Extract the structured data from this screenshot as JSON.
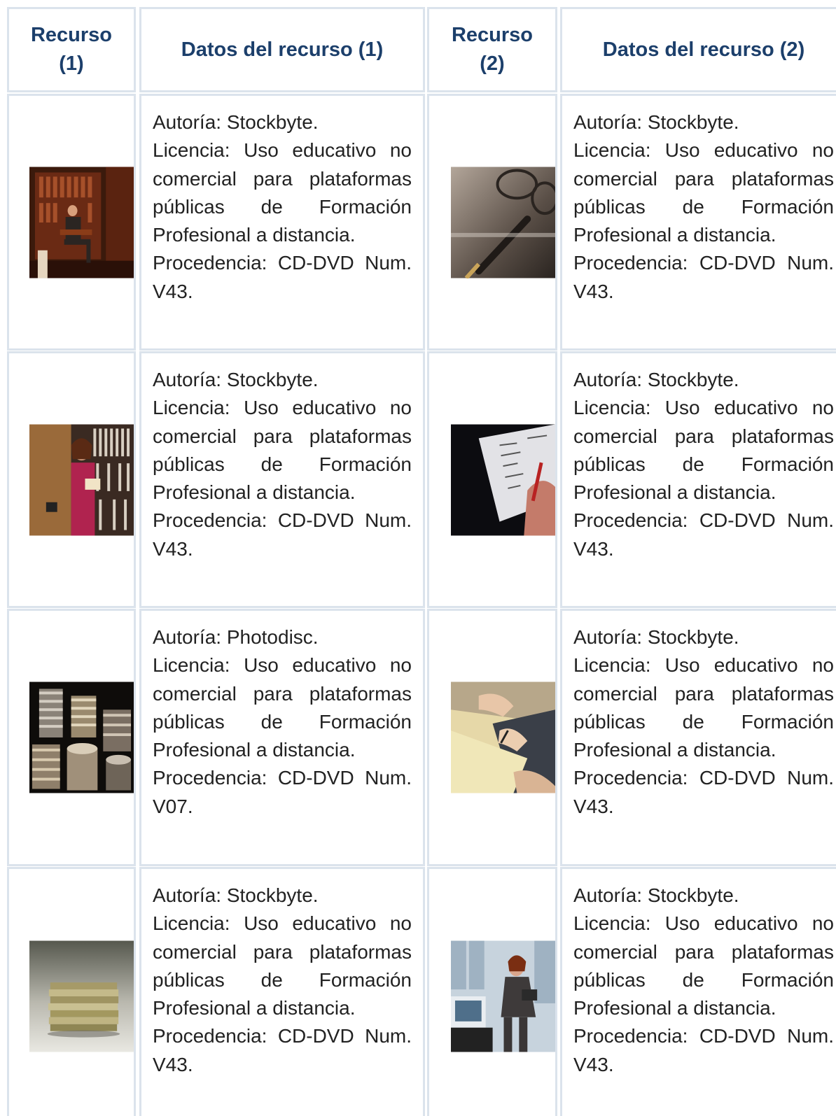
{
  "headers": {
    "recurso1": "Recurso (1)",
    "datos1": "Datos del recurso (1)",
    "recurso2": "Recurso (2)",
    "datos2": "Datos del recurso (2)"
  },
  "rows": [
    {
      "left": {
        "image": "man-seated-in-library-photo",
        "autoria": "Autoría: Stockbyte.",
        "licencia": "Licencia: Uso educativo no comercial para plataformas públicas de Formación Profesional a distancia.",
        "procedencia": "Procedencia: CD-DVD Num. V43."
      },
      "right": {
        "image": "glasses-and-fountain-pen-photo",
        "autoria": "Autoría: Stockbyte.",
        "licencia": "Licencia: Uso educativo no comercial para plataformas públicas de Formación Profesional a distancia.",
        "procedencia": "Procedencia: CD-DVD Num. V43."
      }
    },
    {
      "left": {
        "image": "woman-reading-at-bookshelf-photo",
        "autoria": "Autoría: Stockbyte.",
        "licencia": "Licencia: Uso educativo no comercial para plataformas públicas de Formación Profesional a distancia.",
        "procedencia": "Procedencia: CD-DVD Num. V43."
      },
      "right": {
        "image": "hand-writing-figures-photo",
        "autoria": "Autoría: Stockbyte.",
        "licencia": "Licencia: Uso educativo no comercial para plataformas públicas de Formación Profesional a distancia.",
        "procedencia": "Procedencia: CD-DVD Num. V43."
      }
    },
    {
      "left": {
        "image": "stacked-coins-photo",
        "autoria": "Autoría: Photodisc.",
        "licencia": "Licencia: Uso educativo no comercial para plataformas públicas de Formación Profesional a distancia.",
        "procedencia": "Procedencia: CD-DVD Num. V07."
      },
      "right": {
        "image": "hands-writing-on-paper-photo",
        "autoria": "Autoría: Stockbyte.",
        "licencia": "Licencia: Uso educativo no comercial para plataformas públicas de Formación Profesional a distancia.",
        "procedencia": "Procedencia: CD-DVD Num. V43."
      }
    },
    {
      "left": {
        "image": "stack-of-banknotes-photo",
        "autoria": "Autoría: Stockbyte.",
        "licencia": "Licencia: Uso educativo no comercial para plataformas públicas de Formación Profesional a distancia.",
        "procedencia": "Procedencia: CD-DVD Num. V43."
      },
      "right": {
        "image": "businesswoman-in-office-photo",
        "autoria": "Autoría: Stockbyte.",
        "licencia": "Licencia: Uso educativo no comercial para plataformas públicas de Formación Profesional a distancia.",
        "procedencia": "Procedencia: CD-DVD Num. V43."
      }
    }
  ]
}
